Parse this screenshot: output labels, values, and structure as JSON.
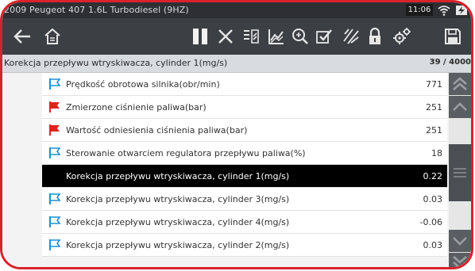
{
  "status": {
    "vehicle": "2009 Peugeot 407 1.6L Turbodiesel (9HZ)",
    "time": "11:06"
  },
  "toolbar": {
    "buttons": [
      "back-icon",
      "home-icon",
      "pause-icon",
      "close-icon",
      "pid-list-icon",
      "graph-icon",
      "zoom-icon",
      "check-icon",
      "lines-icon",
      "lock-icon",
      "settings-icon",
      "save-icon"
    ]
  },
  "header": {
    "title": "Korekcja przepływu wtryskiwacza, cylinder 1(mg/s)",
    "count": "39 / 4000"
  },
  "rows": [
    {
      "label": "Prędkość obrotowa silnika(obr/min)",
      "value": "771",
      "flag": "outline"
    },
    {
      "label": "Zmierzone ciśnienie paliwa(bar)",
      "value": "251",
      "flag": "red"
    },
    {
      "label": "Wartość odniesienia ciśnienia paliwa(bar)",
      "value": "251",
      "flag": "red"
    },
    {
      "label": "Sterowanie otwarciem regulatora przepływu paliwa(%)",
      "value": "18",
      "flag": "outline"
    },
    {
      "label": "Korekcja przepływu wtryskiwacza, cylinder 1(mg/s)",
      "value": "0.22",
      "flag": "none"
    },
    {
      "label": "Korekcja przepływu wtryskiwacza, cylinder 3(mg/s)",
      "value": "0.03",
      "flag": "outline"
    },
    {
      "label": "Korekcja przepływu wtryskiwacza, cylinder 4(mg/s)",
      "value": "-0.06",
      "flag": "outline"
    },
    {
      "label": "Korekcja przepływu wtryskiwacza, cylinder 2(mg/s)",
      "value": "0.03",
      "flag": "outline"
    }
  ],
  "colors": {
    "frame": "#d8232a",
    "flag_outline": "#1f8fd6",
    "flag_red": "#e2231a",
    "toolbar": "#3c3f44"
  }
}
